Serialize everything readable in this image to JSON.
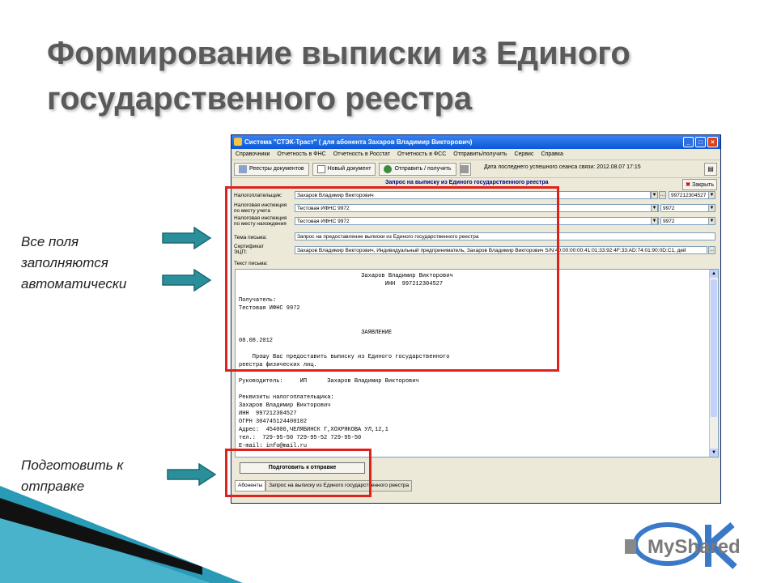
{
  "slide": {
    "title": "Формирование выписки из Единого государственного реестра",
    "note_top": [
      "Все поля",
      "заполняются",
      "автоматически"
    ],
    "note_bottom": [
      "Подготовить к",
      "отправке"
    ],
    "logo_text": "MyShared"
  },
  "window": {
    "title": "Система \"СТЭК-Траст\" ( для абонента Захаров Владимир Викторович)",
    "menu": [
      "Справочники",
      "Отчетность в ФНС",
      "Отчетность в Росстат",
      "Отчетность в ФСС",
      "Отправить/получить",
      "Сервис",
      "Справка"
    ],
    "toolbar": {
      "registers": "Реестры документов",
      "new_doc": "Новый документ",
      "send_receive": "Отправить / получить",
      "last_session": "Дата последнего успешного сеанса связи: 2012.08.07 17:15"
    },
    "form_title": "Запрос на выписку из Единого государственного реестра",
    "close_label": "Закрыть",
    "fields": {
      "taxpayer_label": "Налогоплательщик:",
      "taxpayer_value": "Захаров Владимир Викторович",
      "taxpayer_inn": "997212304527",
      "insp_reg_label_1": "Налоговая инспекция",
      "insp_reg_label_2": "по месту учета",
      "insp_reg_value": "Тестовая ИФНС 9972",
      "insp_reg_code": "9972",
      "insp_loc_label_1": "Налоговая инспекция",
      "insp_loc_label_2": "по месту нахождения",
      "insp_loc_value": "Тестовая ИФНС 9972",
      "insp_loc_code": "9972",
      "subject_label": "Тема письма:",
      "subject_value": "Запрос на предоставление выписки из Единого государственного реестра",
      "cert_label_1": "Сертификат",
      "cert_label_2": "ЭЦП:",
      "cert_value": "Захаров Владимир Викторович, Индивидуальный предприниматель, Захаров Владимир Викторович S/N:40:00:00:00:41:01:33:92:4F:33:AD:74:01:90:0D:C1, дей",
      "body_label": "Текст письма:"
    },
    "letter_text": "                                    Захаров Владимир Викторович\n                                           ИНН  997212304527\n\nПолучатель:\nТестовая ИФНС 9972\n\n\n                                    ЗАЯВЛЕНИЕ\n08.08.2012\n\n    Прошу Вас предоставить выписку из Единого государственного\nреестра физических лиц.\n\nРуководитель:     ИП      Захаров Владимир Викторович\n\nРеквизиты налогоплательщика:\nЗахаров Владимир Викторович\nИНН  997212304527\nОГРН 304745124400102\nАдрес:  454000,ЧЕЛЯБИНСК Г,ХОХРЯКОВА УЛ,12,1\nтел.:  729-95-50 729-95-52 729-95-50\nE-mail: info@mail.ru",
    "prepare_button": "Подготовить к отправке",
    "tabs": [
      "Абоненты",
      "Запрос на выписку из Единого государственного реестра"
    ]
  },
  "colors": {
    "title_text": "#5a5a5a",
    "highlight": "#e0201a",
    "arrow": "#2a8f9a",
    "titlebar": "#0a58d8"
  }
}
